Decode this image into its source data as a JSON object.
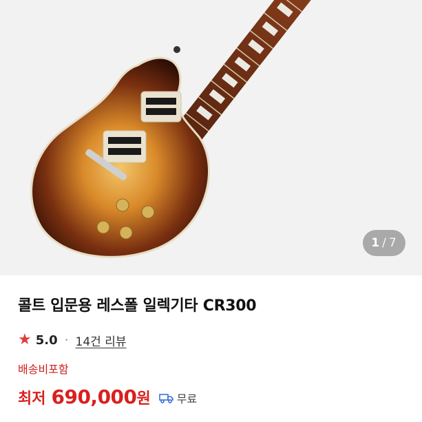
{
  "gallery": {
    "current": "1",
    "separator": "/",
    "total": "7"
  },
  "product": {
    "title": "콜트 입문용 레스폴 일렉기타 CR300",
    "rating": "5.0",
    "review_link": "14건 리뷰",
    "shipping_note": "배송비포함",
    "price_prefix": "최저",
    "price_value": "690,000",
    "price_unit": "원",
    "delivery_label": "무료"
  },
  "colors": {
    "accent_red": "#d9201e",
    "star": "#e03c3c"
  },
  "icons": {
    "rating": "star-icon",
    "delivery": "truck-icon"
  }
}
